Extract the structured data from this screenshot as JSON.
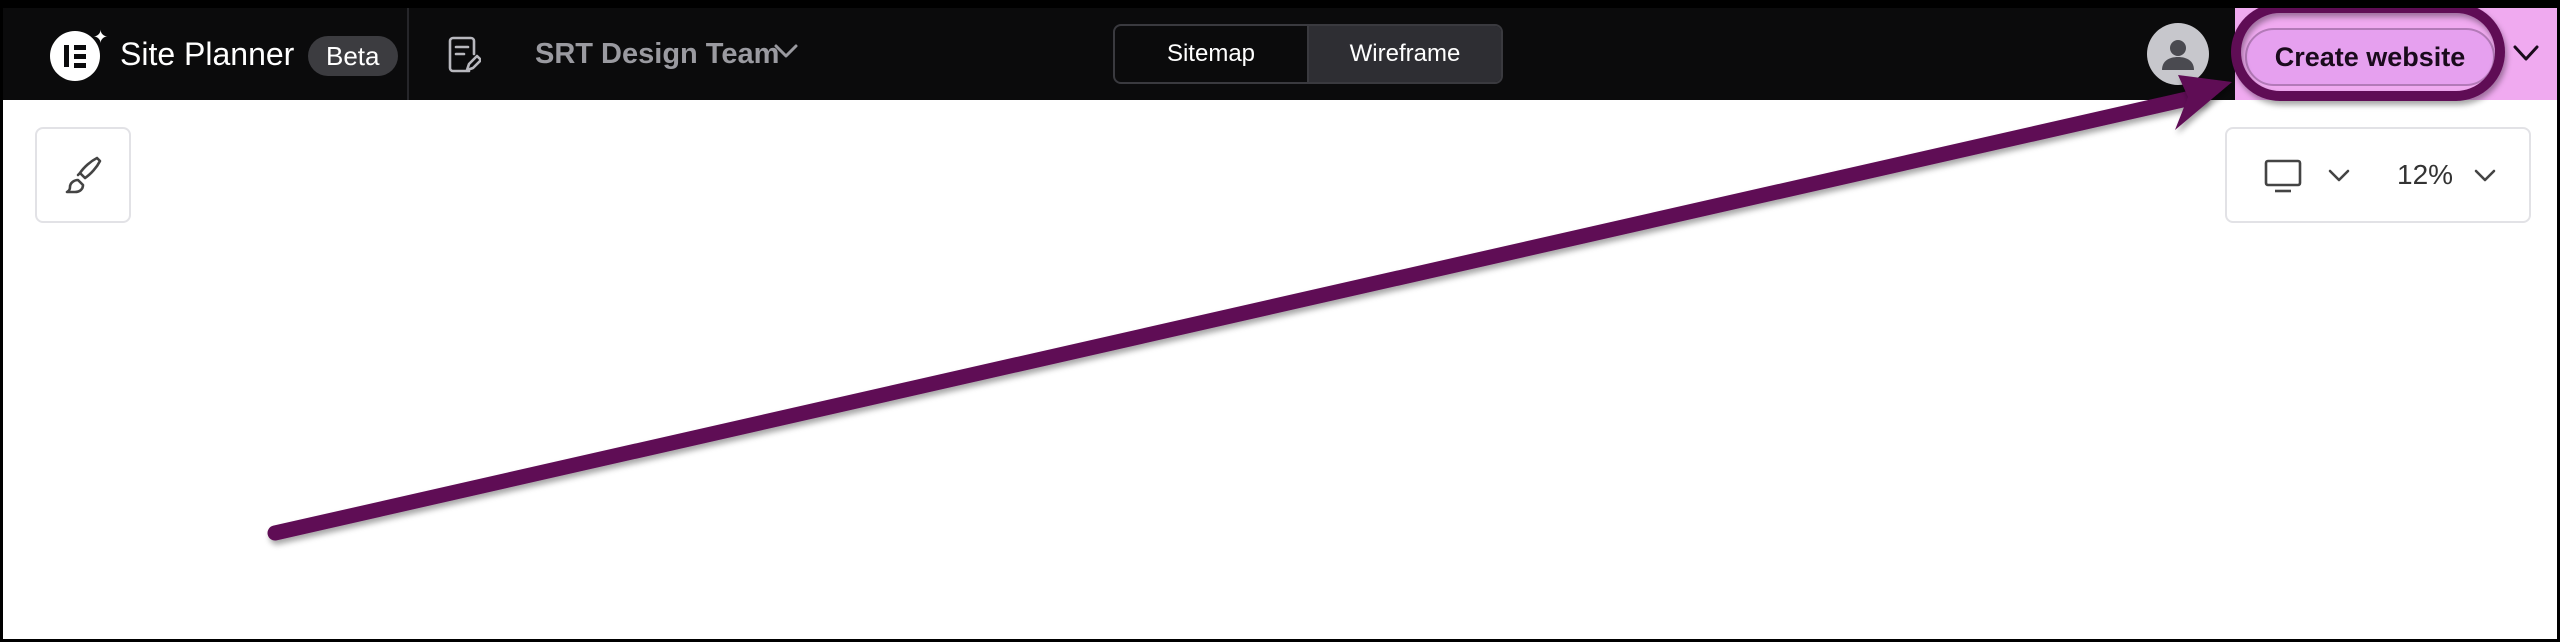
{
  "app": {
    "title": "Site Planner",
    "badge": "Beta"
  },
  "team": {
    "name": "SRT Design Team"
  },
  "view_toggle": {
    "tabs": [
      "Sitemap",
      "Wireframe"
    ],
    "active": "Wireframe"
  },
  "actions": {
    "create_label": "Create website"
  },
  "zoom": {
    "value": "12%",
    "device": "desktop-icon"
  },
  "icons": {
    "logo": "elementor-logo",
    "sparkle": "sparkle-icon",
    "pages": "document-edit-icon",
    "avatar": "user-avatar-icon",
    "brush": "brush-icon",
    "chevron": "chevron-down-icon"
  },
  "colors": {
    "topbar": "#0b0b0c",
    "highlight": "#f0aaf0",
    "annotation": "#5f0a55"
  }
}
